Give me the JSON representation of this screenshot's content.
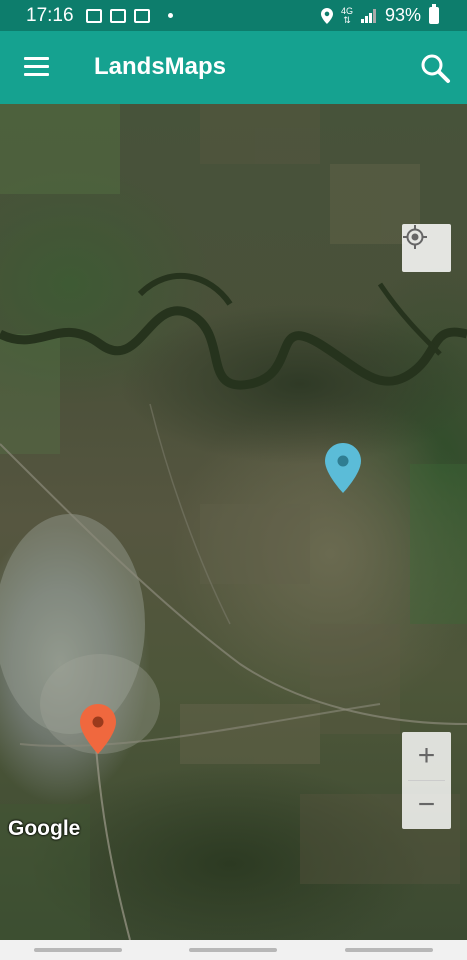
{
  "status_bar": {
    "time": "17:16",
    "network": "4G",
    "battery": "93%"
  },
  "app_bar": {
    "title": "LandsMaps",
    "icons": [
      "menu-icon",
      "search-icon"
    ]
  },
  "map": {
    "attribution": "Google",
    "zoom_in_label": "+",
    "zoom_out_label": "−",
    "markers": [
      {
        "color": "#5bbcd8",
        "name": "blue-marker"
      },
      {
        "color": "#f0683e",
        "name": "orange-marker"
      }
    ]
  },
  "colors": {
    "status_bar": "#0d7d6c",
    "app_bar": "#15a290",
    "nav_bar": "#f1f1f1"
  }
}
